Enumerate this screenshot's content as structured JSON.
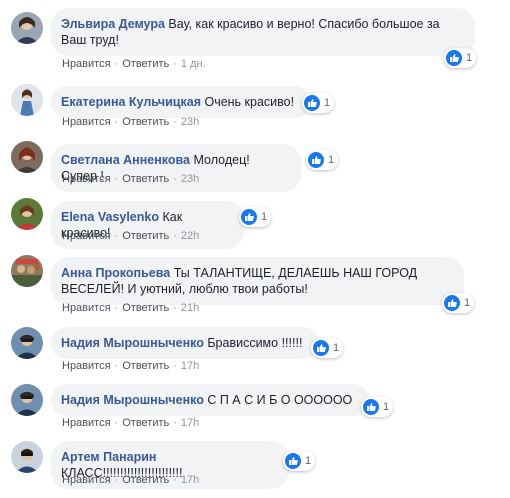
{
  "colors": {
    "author": "#385898",
    "bubble": "#f2f3f5",
    "like": "#1877f2",
    "meta": "#90949c"
  },
  "actions": {
    "like_label": "Нравится",
    "reply_label": "Ответить",
    "separator": "·"
  },
  "reaction_icon": "thumbs-up-icon",
  "comments": [
    {
      "author": "Эльвира Демура",
      "text": "Вау, как красиво и верно! Спасибо большое за Ваш труд!",
      "likes": "1",
      "time": "1 дн."
    },
    {
      "author": "Екатерина Кульчицкая",
      "text": "Очень красиво!",
      "likes": "1",
      "time": "23h"
    },
    {
      "author": "Светлана Анненкова",
      "text": "Молодец! Супер !",
      "likes": "1",
      "time": "23h"
    },
    {
      "author": "Elena Vasylenko",
      "text": "Как красиво!",
      "likes": "1",
      "time": "22h"
    },
    {
      "author": "Анна Прокопьева",
      "text": "Ты ТАЛАНТИЩЕ, ДЕЛАЕШЬ НАШ ГОРОД ВЕСЕЛЕЙ! И уютний, люблю твои работы!",
      "likes": "1",
      "time": "21h"
    },
    {
      "author": "Надия Мырошныченко",
      "text": "Брависсимо !!!!!!",
      "likes": "1",
      "time": "17h"
    },
    {
      "author": "Надия Мырошныченко",
      "text": "С П А С И Б О ОООООО",
      "likes": "1",
      "time": "17h"
    },
    {
      "author": "Артем Панарин",
      "text": "КЛАСС!!!!!!!!!!!!!!!!!!!!!!!",
      "likes": "1",
      "time": "17h"
    }
  ]
}
